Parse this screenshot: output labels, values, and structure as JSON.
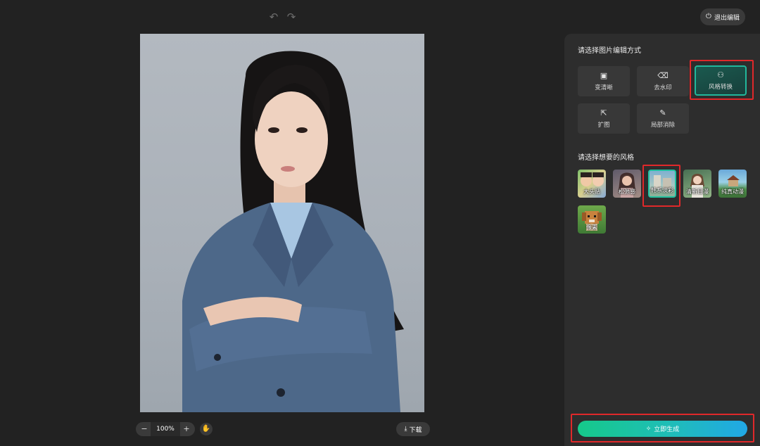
{
  "toolbar": {
    "undo_icon": "undo-icon",
    "redo_icon": "redo-icon",
    "exit_label": "退出编辑",
    "exit_icon": "power-icon"
  },
  "canvas": {
    "zoom_level": "100%",
    "zoom_out_glyph": "−",
    "zoom_in_glyph": "+",
    "download_label": "下载"
  },
  "panel": {
    "edit_mode_title": "请选择图片编辑方式",
    "tools": [
      {
        "label": "变清晰",
        "icon": "hd-icon"
      },
      {
        "label": "去水印",
        "icon": "eraser-icon"
      },
      {
        "label": "风格转换",
        "icon": "style-circles-icon",
        "active": true
      },
      {
        "label": "扩图",
        "icon": "expand-icon"
      },
      {
        "label": "局部消除",
        "icon": "brush-erase-icon"
      }
    ],
    "style_title": "请选择想要的风格",
    "styles": [
      {
        "label": "大头贴"
      },
      {
        "label": "松弛感"
      },
      {
        "label": "韩系淡彩",
        "selected": true
      },
      {
        "label": "清新日漫"
      },
      {
        "label": "纯真动漫"
      },
      {
        "label": "像素"
      }
    ],
    "generate_label": "立即生成"
  },
  "colors": {
    "accent_green": "#16c98a",
    "accent_blue": "#21a8e6",
    "highlight_red": "#e0282a",
    "selected_border": "#22c2a0"
  }
}
